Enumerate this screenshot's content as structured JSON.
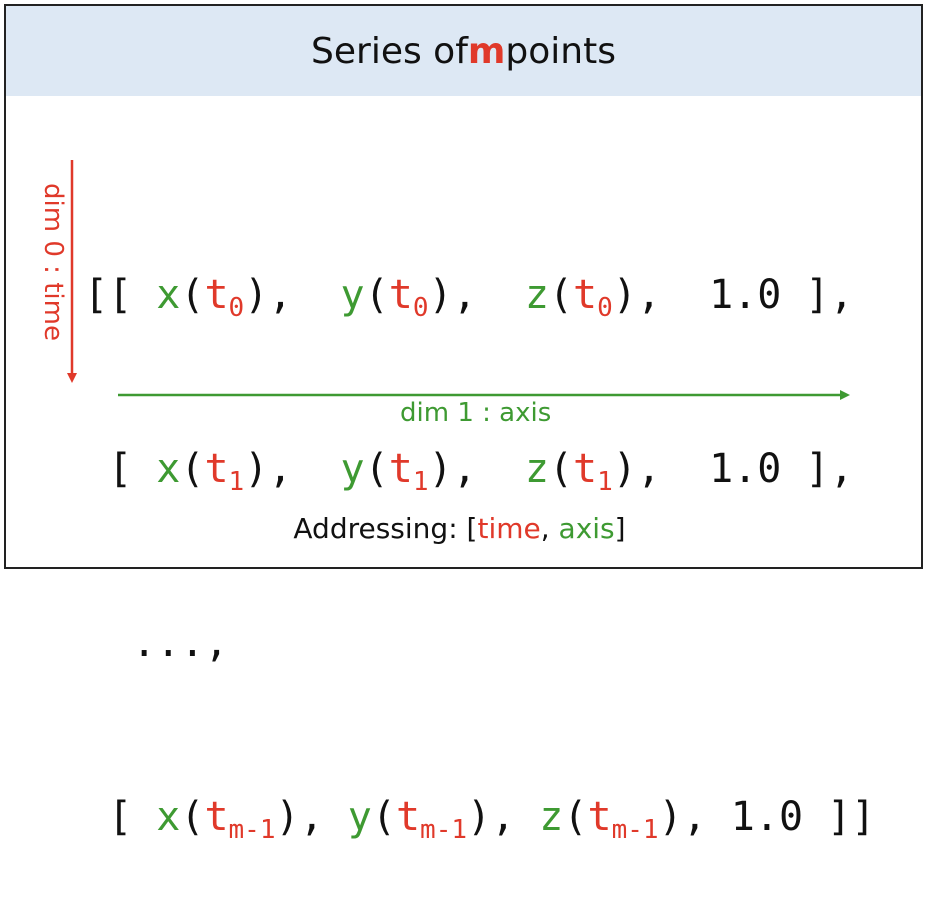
{
  "title": {
    "prefix": "Series of ",
    "highlight": "m",
    "suffix": " points",
    "highlight_color": "#e0392a"
  },
  "matrix": {
    "rows": [
      {
        "open": "[[ ",
        "cells": [
          {
            "fn": "x",
            "pad_after": ",  ",
            "t": "t",
            "sub": "0"
          },
          {
            "fn": "y",
            "pad_after": ",  ",
            "t": "t",
            "sub": "0"
          },
          {
            "fn": "z",
            "pad_after": ",  ",
            "t": "t",
            "sub": "0"
          }
        ],
        "const": "1.0",
        "close": " ],"
      },
      {
        "open": " [ ",
        "cells": [
          {
            "fn": "x",
            "pad_after": ",  ",
            "t": "t",
            "sub": "1"
          },
          {
            "fn": "y",
            "pad_after": ",  ",
            "t": "t",
            "sub": "1"
          },
          {
            "fn": "z",
            "pad_after": ",  ",
            "t": "t",
            "sub": "1"
          }
        ],
        "const": "1.0",
        "close": " ],"
      },
      {
        "ellipsis": "  ...,"
      },
      {
        "open": " [ ",
        "cells": [
          {
            "fn": "x",
            "pad_after": ", ",
            "t": "t",
            "sub": "m-1"
          },
          {
            "fn": "y",
            "pad_after": ", ",
            "t": "t",
            "sub": "m-1"
          },
          {
            "fn": "z",
            "pad_after": ", ",
            "t": "t",
            "sub": "m-1"
          }
        ],
        "const": "1.0",
        "close": " ]]"
      }
    ]
  },
  "dim0": {
    "label": "dim 0 : time",
    "color": "#e0392a"
  },
  "dim1": {
    "label": "dim 1 : axis",
    "color": "#3e9a32"
  },
  "addressing": {
    "prefix": "Addressing: [",
    "first": "time",
    "separator": ", ",
    "second": "axis",
    "suffix": "]"
  },
  "colors": {
    "header_bg": "#dde8f4",
    "function": "#3e9a32",
    "time": "#e0392a",
    "text": "#111111",
    "border": "#222222"
  }
}
